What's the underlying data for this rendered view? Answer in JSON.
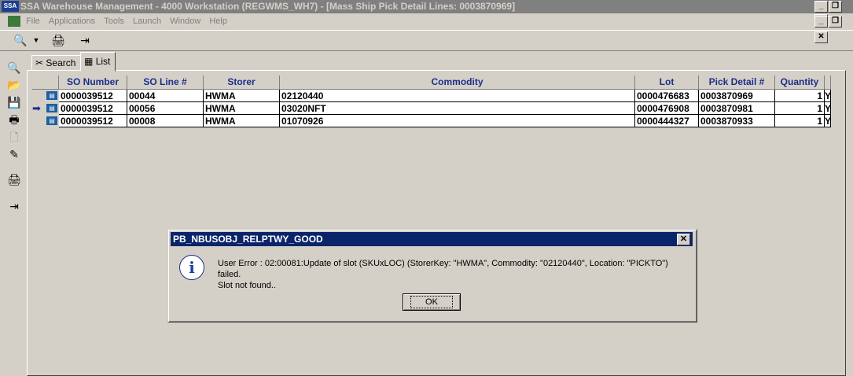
{
  "window": {
    "app_icon": "SSA",
    "title": "SSA Warehouse Management - 4000 Workstation (REGWMS_WH7) - [Mass Ship Pick Detail Lines: 0003870969]"
  },
  "menu": {
    "items": [
      {
        "label": "File"
      },
      {
        "label": "Applications"
      },
      {
        "label": "Tools"
      },
      {
        "label": "Launch"
      },
      {
        "label": "Window"
      },
      {
        "label": "Help"
      }
    ]
  },
  "tabs": [
    {
      "label": "Search"
    },
    {
      "label": "List"
    }
  ],
  "grid": {
    "columns": [
      "SO Number",
      "SO Line #",
      "Storer",
      "Commodity",
      "Lot",
      "Pick Detail #",
      "Quantity"
    ],
    "rows": [
      {
        "so_number": "0000039512",
        "so_line": "00044",
        "storer": "HWMA",
        "commodity": "02120440",
        "lot": "0000476683",
        "pick_detail": "0003870969",
        "quantity": "1",
        "extra": "Y"
      },
      {
        "so_number": "0000039512",
        "so_line": "00056",
        "storer": "HWMA",
        "commodity": "03020NFT",
        "lot": "0000476908",
        "pick_detail": "0003870981",
        "quantity": "1",
        "extra": "Y"
      },
      {
        "so_number": "0000039512",
        "so_line": "00008",
        "storer": "HWMA",
        "commodity": "01070926",
        "lot": "0000444327",
        "pick_detail": "0003870933",
        "quantity": "1",
        "extra": "Y"
      }
    ]
  },
  "dialog": {
    "title": "PB_NBUSOBJ_RELPTWY_GOOD",
    "message_line1": "User Error : 02:00081:Update of slot (SKUxLOC) (StorerKey: \"HWMA\", Commodity: \"02120440\", Location: \"PICKTO\") failed.",
    "message_line2": "Slot not found..",
    "ok_label": "OK",
    "close_glyph": "✕",
    "icon_glyph": "i"
  }
}
